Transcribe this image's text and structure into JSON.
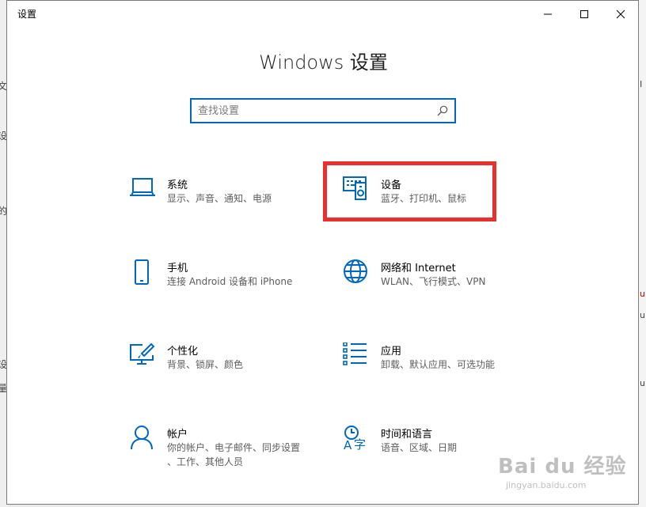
{
  "window": {
    "title": "设置"
  },
  "controls": {
    "minimize": "minimize",
    "maximize": "maximize",
    "close": "close"
  },
  "heading": "Windows 设置",
  "search": {
    "placeholder": "查找设置",
    "value": ""
  },
  "tiles": [
    {
      "icon": "laptop-icon",
      "name": "系统",
      "desc": "显示、声音、通知、电源"
    },
    {
      "icon": "devices-icon",
      "name": "设备",
      "desc": "蓝牙、打印机、鼠标"
    },
    {
      "icon": "phone-icon",
      "name": "手机",
      "desc": "连接 Android 设备和 iPhone"
    },
    {
      "icon": "globe-icon",
      "name": "网络和 Internet",
      "desc": "WLAN、飞行模式、VPN"
    },
    {
      "icon": "personalization-icon",
      "name": "个性化",
      "desc": "背景、锁屏、颜色"
    },
    {
      "icon": "apps-icon",
      "name": "应用",
      "desc": "卸载、默认应用、可选功能"
    },
    {
      "icon": "account-icon",
      "name": "帐户",
      "desc": "你的帐户、电子邮件、同步设置、工作、其他人员"
    },
    {
      "icon": "time-language-icon",
      "name": "时间和语言",
      "desc": "语音、区域、日期"
    }
  ],
  "tile_desc_lines": {
    "account_line1": "你的帐户、电子邮件、同步设置",
    "account_line2": "、工作、其他人员"
  },
  "watermark": {
    "line1": "Bai du 经验",
    "line2": "jingyan.baidu.com"
  },
  "colors": {
    "accent": "#0067c0",
    "highlight": "#e8312f"
  }
}
